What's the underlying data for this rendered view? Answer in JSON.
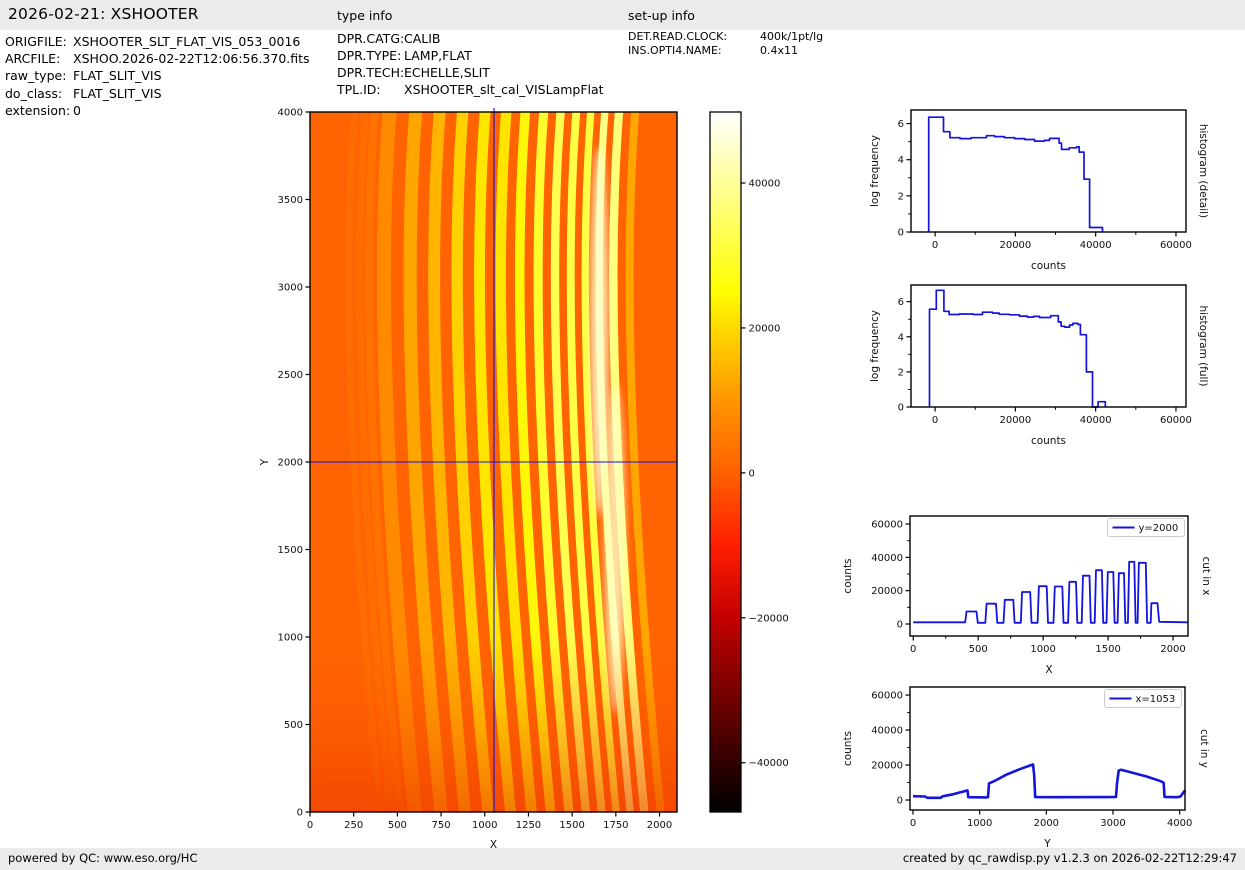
{
  "header": {
    "title": "2026-02-21: XSHOOTER",
    "type_info_title": "type info",
    "setup_info_title": "set-up info"
  },
  "file_info": {
    "rows": [
      {
        "label": "ORIGFILE:",
        "value": "XSHOOTER_SLT_FLAT_VIS_053_0016"
      },
      {
        "label": "ARCFILE:",
        "value": "XSHOO.2026-02-22T12:06:56.370.fits"
      },
      {
        "label": "raw_type:",
        "value": "FLAT_SLIT_VIS"
      },
      {
        "label": "do_class:",
        "value": "FLAT_SLIT_VIS"
      },
      {
        "label": "extension:",
        "value": "0"
      }
    ]
  },
  "type_info": {
    "rows": [
      {
        "label": "DPR.CATG:",
        "value": "CALIB"
      },
      {
        "label": "DPR.TYPE:",
        "value": "LAMP,FLAT"
      },
      {
        "label": "DPR.TECH:",
        "value": "ECHELLE,SLIT"
      },
      {
        "label": "TPL.ID:",
        "value": "XSHOOTER_slt_cal_VISLampFlat"
      }
    ]
  },
  "setup_info": {
    "rows": [
      {
        "label": "DET.READ.CLOCK:",
        "value": "400k/1pt/lg"
      },
      {
        "label": "INS.OPTI4.NAME:",
        "value": "0.4x11"
      }
    ]
  },
  "footer": {
    "left": "powered by QC: www.eso.org/HC",
    "right": "created by qc_rawdisp.py v1.2.3 on 2026-02-22T12:29:47"
  },
  "colors": {
    "accent_blue": "#1414dd",
    "bar_bg": "#ebebeb",
    "image_background": "#ff6302"
  },
  "chart_data": [
    {
      "id": "image",
      "type": "heatmap",
      "xlabel": "X",
      "ylabel": "Y",
      "xlim": [
        0,
        2100
      ],
      "ylim": [
        0,
        4000
      ],
      "xticks": {
        "major": [
          0,
          250,
          500,
          750,
          1000,
          1250,
          1500,
          1750,
          2000
        ],
        "minor": []
      },
      "yticks": {
        "major": [
          0,
          500,
          1000,
          1500,
          2000,
          2500,
          3000,
          3500,
          4000
        ],
        "minor": []
      },
      "background": "#ff6302",
      "crosshair": {
        "x": 1053,
        "y": 2000
      },
      "faint_bands": [
        {
          "x": 250,
          "w": 40,
          "color": "#ff7500",
          "opacity": 0.5
        },
        {
          "x": 310,
          "w": 42,
          "color": "#ff7500",
          "opacity": 0.6
        },
        {
          "x": 365,
          "w": 46,
          "color": "#ff7800",
          "opacity": 0.7
        }
      ],
      "bands": [
        {
          "x": 450,
          "w": 80,
          "color": "#ff8a00"
        },
        {
          "x": 600,
          "w": 75,
          "color": "#ffa500"
        },
        {
          "x": 737,
          "w": 68,
          "color": "#ffb400"
        },
        {
          "x": 869,
          "w": 65,
          "color": "#ffd100"
        },
        {
          "x": 997,
          "w": 62,
          "color": "#ffe600"
        },
        {
          "x": 1118,
          "w": 60,
          "color": "#ffe400"
        },
        {
          "x": 1227,
          "w": 55,
          "color": "#fff70a"
        },
        {
          "x": 1332,
          "w": 52,
          "color": "#fffd2e"
        },
        {
          "x": 1429,
          "w": 48,
          "color": "#ffff52"
        },
        {
          "x": 1519,
          "w": 45,
          "color": "#ffff46"
        },
        {
          "x": 1602,
          "w": 42,
          "color": "#ffff3e"
        },
        {
          "x": 1682,
          "w": 42,
          "color": "#ffff85"
        },
        {
          "x": 1763,
          "w": 48,
          "color": "#ffff7a"
        },
        {
          "x": 1856,
          "w": 45,
          "color": "#ffa600"
        }
      ]
    },
    {
      "id": "colorbar",
      "type": "colorbar",
      "vmin": -46800,
      "vmax": 49800,
      "ticks": [
        {
          "value": 40000,
          "label": "40000"
        },
        {
          "value": 20000,
          "label": "20000"
        },
        {
          "value": 0,
          "label": "0"
        },
        {
          "value": -20000,
          "label": "−20000"
        },
        {
          "value": -40000,
          "label": "−40000"
        }
      ],
      "gradient": [
        [
          0,
          "#ffffff"
        ],
        [
          0.101,
          "#ffff9a"
        ],
        [
          0.205,
          "#ffff31"
        ],
        [
          0.257,
          "#fffd00"
        ],
        [
          0.308,
          "#ffda00"
        ],
        [
          0.412,
          "#ff9500"
        ],
        [
          0.516,
          "#ff6000"
        ],
        [
          0.619,
          "#ff1e00"
        ],
        [
          0.723,
          "#c20000"
        ],
        [
          0.826,
          "#7a0000"
        ],
        [
          0.93,
          "#310000"
        ],
        [
          1,
          "#000000"
        ]
      ]
    },
    {
      "id": "hist_detail",
      "type": "line",
      "right_label": "histogram (detail)",
      "xlabel": "counts",
      "ylabel": "log frequency",
      "color": "#1414dd",
      "lw": 1.7,
      "xlim": [
        -6000,
        62500
      ],
      "ylim": [
        0,
        6.75
      ],
      "xticks": {
        "major": [
          0,
          20000,
          40000,
          60000
        ],
        "minor": [
          10000,
          30000,
          50000
        ]
      },
      "yticks": {
        "major": [
          0,
          2,
          4,
          6
        ],
        "minor": [
          1,
          3,
          5
        ]
      },
      "points": [
        [
          -1600,
          0
        ],
        [
          -1600,
          6.35
        ],
        [
          2100,
          6.35
        ],
        [
          2100,
          5.55
        ],
        [
          3700,
          5.55
        ],
        [
          3700,
          5.22
        ],
        [
          6200,
          5.22
        ],
        [
          6200,
          5.17
        ],
        [
          9000,
          5.17
        ],
        [
          9000,
          5.22
        ],
        [
          12800,
          5.22
        ],
        [
          12800,
          5.33
        ],
        [
          14800,
          5.33
        ],
        [
          14800,
          5.28
        ],
        [
          17300,
          5.28
        ],
        [
          17300,
          5.22
        ],
        [
          19800,
          5.22
        ],
        [
          19800,
          5.17
        ],
        [
          22300,
          5.17
        ],
        [
          22300,
          5.12
        ],
        [
          24800,
          5.12
        ],
        [
          24800,
          5.03
        ],
        [
          27200,
          5.03
        ],
        [
          27200,
          5.07
        ],
        [
          28500,
          5.07
        ],
        [
          28500,
          5.18
        ],
        [
          30900,
          5.18
        ],
        [
          30900,
          4.92
        ],
        [
          31500,
          4.92
        ],
        [
          31500,
          4.57
        ],
        [
          33400,
          4.57
        ],
        [
          33400,
          4.66
        ],
        [
          35300,
          4.66
        ],
        [
          35300,
          4.71
        ],
        [
          35900,
          4.71
        ],
        [
          35900,
          4.42
        ],
        [
          37100,
          4.42
        ],
        [
          37100,
          2.92
        ],
        [
          38500,
          2.92
        ],
        [
          38500,
          0.25
        ],
        [
          41700,
          0.25
        ],
        [
          41700,
          0
        ]
      ]
    },
    {
      "id": "hist_full",
      "type": "line",
      "right_label": "histogram (full)",
      "xlabel": "counts",
      "ylabel": "log frequency",
      "color": "#1414dd",
      "lw": 1.7,
      "xlim": [
        -6000,
        62500
      ],
      "ylim": [
        0,
        6.95
      ],
      "xticks": {
        "major": [
          0,
          20000,
          40000,
          60000
        ],
        "minor": [
          10000,
          30000,
          50000
        ]
      },
      "yticks": {
        "major": [
          0,
          2,
          4,
          6
        ],
        "minor": [
          1,
          3,
          5
        ]
      },
      "points": [
        [
          -1400,
          0
        ],
        [
          -1400,
          5.57
        ],
        [
          300,
          5.57
        ],
        [
          300,
          6.65
        ],
        [
          2200,
          6.65
        ],
        [
          2200,
          5.45
        ],
        [
          3500,
          5.45
        ],
        [
          3500,
          5.27
        ],
        [
          6000,
          5.27
        ],
        [
          6000,
          5.3
        ],
        [
          9500,
          5.3
        ],
        [
          9500,
          5.27
        ],
        [
          11800,
          5.27
        ],
        [
          11800,
          5.4
        ],
        [
          14300,
          5.4
        ],
        [
          14300,
          5.35
        ],
        [
          16000,
          5.35
        ],
        [
          16000,
          5.28
        ],
        [
          18500,
          5.28
        ],
        [
          18500,
          5.25
        ],
        [
          21000,
          5.25
        ],
        [
          21000,
          5.18
        ],
        [
          23000,
          5.18
        ],
        [
          23000,
          5.12
        ],
        [
          24500,
          5.12
        ],
        [
          24500,
          5.16
        ],
        [
          26000,
          5.16
        ],
        [
          26000,
          5.1
        ],
        [
          28800,
          5.1
        ],
        [
          28800,
          5.2
        ],
        [
          30700,
          5.2
        ],
        [
          30700,
          4.85
        ],
        [
          31400,
          4.85
        ],
        [
          31400,
          4.6
        ],
        [
          32300,
          4.6
        ],
        [
          32300,
          4.55
        ],
        [
          33500,
          4.55
        ],
        [
          33500,
          4.67
        ],
        [
          34300,
          4.67
        ],
        [
          34300,
          4.76
        ],
        [
          35600,
          4.76
        ],
        [
          35600,
          4.7
        ],
        [
          36200,
          4.7
        ],
        [
          36200,
          4.12
        ],
        [
          37700,
          4.12
        ],
        [
          37700,
          2.0
        ],
        [
          39200,
          2.0
        ],
        [
          39200,
          0
        ],
        [
          40600,
          0
        ],
        [
          40600,
          0.3
        ],
        [
          42400,
          0.3
        ],
        [
          42400,
          0
        ]
      ]
    },
    {
      "id": "cut_x",
      "type": "line",
      "right_label": "cut in x",
      "xlabel": "X",
      "ylabel": "counts",
      "legend": "y=2000",
      "color": "#1414dd",
      "lw": 1.8,
      "xlim": [
        -25,
        2115
      ],
      "ylim": [
        -7200,
        64800
      ],
      "xticks": {
        "major": [
          0,
          500,
          1000,
          1500,
          2000
        ],
        "minor": [
          250,
          750,
          1250,
          1750
        ]
      },
      "yticks": {
        "major": [
          0,
          20000,
          40000,
          60000
        ],
        "minor": [
          10000,
          30000,
          50000
        ]
      },
      "points": [
        [
          0,
          1000
        ],
        [
          400,
          1000
        ],
        [
          410,
          7500
        ],
        [
          487,
          7500
        ],
        [
          497,
          700
        ],
        [
          555,
          700
        ],
        [
          565,
          12200
        ],
        [
          637,
          12200
        ],
        [
          647,
          700
        ],
        [
          695,
          700
        ],
        [
          705,
          14500
        ],
        [
          770,
          14500
        ],
        [
          780,
          700
        ],
        [
          828,
          700
        ],
        [
          838,
          19200
        ],
        [
          900,
          19200
        ],
        [
          910,
          700
        ],
        [
          957,
          700
        ],
        [
          967,
          22700
        ],
        [
          1027,
          22700
        ],
        [
          1037,
          700
        ],
        [
          1080,
          700
        ],
        [
          1090,
          22500
        ],
        [
          1147,
          22500
        ],
        [
          1157,
          700
        ],
        [
          1192,
          700
        ],
        [
          1202,
          25300
        ],
        [
          1253,
          25300
        ],
        [
          1263,
          700
        ],
        [
          1297,
          700
        ],
        [
          1307,
          29000
        ],
        [
          1357,
          29000
        ],
        [
          1367,
          700
        ],
        [
          1397,
          700
        ],
        [
          1407,
          32300
        ],
        [
          1452,
          32300
        ],
        [
          1462,
          700
        ],
        [
          1488,
          700
        ],
        [
          1498,
          31200
        ],
        [
          1540,
          31200
        ],
        [
          1550,
          700
        ],
        [
          1573,
          700
        ],
        [
          1583,
          30500
        ],
        [
          1622,
          30500
        ],
        [
          1632,
          700
        ],
        [
          1652,
          700
        ],
        [
          1662,
          37300
        ],
        [
          1702,
          37300
        ],
        [
          1712,
          700
        ],
        [
          1727,
          700
        ],
        [
          1737,
          36700
        ],
        [
          1790,
          36700
        ],
        [
          1800,
          700
        ],
        [
          1828,
          700
        ],
        [
          1833,
          12500
        ],
        [
          1880,
          12500
        ],
        [
          1893,
          1300
        ],
        [
          2110,
          1000
        ]
      ]
    },
    {
      "id": "cut_y",
      "type": "line",
      "right_label": "cut in y",
      "xlabel": "Y",
      "ylabel": "counts",
      "legend": "x=1053",
      "color": "#1414dd",
      "lw": 2.6,
      "xlim": [
        -45,
        4080
      ],
      "ylim": [
        -5700,
        64600
      ],
      "xticks": {
        "major": [
          0,
          1000,
          2000,
          3000,
          4000
        ],
        "minor": []
      },
      "yticks": {
        "major": [
          0,
          20000,
          40000,
          60000
        ],
        "minor": [
          10000,
          30000,
          50000
        ]
      },
      "points": [
        [
          0,
          2200
        ],
        [
          180,
          2000
        ],
        [
          215,
          1300
        ],
        [
          420,
          1300
        ],
        [
          440,
          2100
        ],
        [
          600,
          3300
        ],
        [
          800,
          5300
        ],
        [
          818,
          5500
        ],
        [
          830,
          1600
        ],
        [
          1100,
          1500
        ],
        [
          1125,
          1700
        ],
        [
          1140,
          9500
        ],
        [
          1220,
          10800
        ],
        [
          1400,
          14500
        ],
        [
          1600,
          17600
        ],
        [
          1760,
          19800
        ],
        [
          1800,
          20300
        ],
        [
          1818,
          14000
        ],
        [
          1833,
          1700
        ],
        [
          2100,
          1600
        ],
        [
          2900,
          1700
        ],
        [
          3045,
          1800
        ],
        [
          3060,
          9500
        ],
        [
          3085,
          16800
        ],
        [
          3120,
          17300
        ],
        [
          3300,
          15500
        ],
        [
          3500,
          13500
        ],
        [
          3700,
          11000
        ],
        [
          3745,
          10200
        ],
        [
          3760,
          9800
        ],
        [
          3772,
          1800
        ],
        [
          3950,
          1600
        ],
        [
          4010,
          1900
        ],
        [
          4080,
          5500
        ]
      ]
    }
  ]
}
